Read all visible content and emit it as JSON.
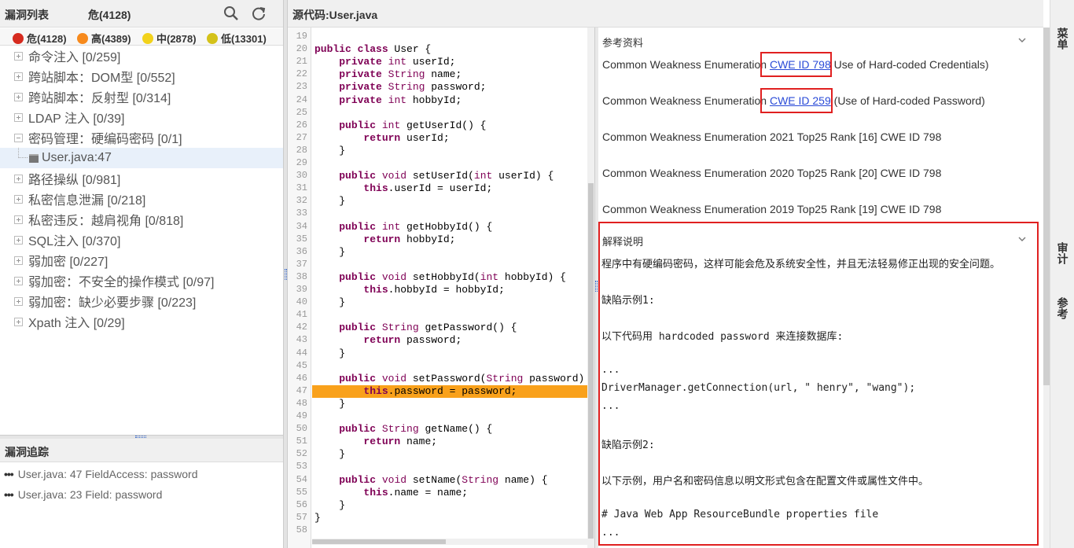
{
  "left_panel": {
    "title": "漏洞列表",
    "high_summary": "危(4128)",
    "search_icon": "search-icon",
    "refresh_icon": "refresh-icon",
    "severity": [
      {
        "label": "危(4128)",
        "color": "#d62b1f"
      },
      {
        "label": "高(4389)",
        "color": "#f78a1d"
      },
      {
        "label": "中(2878)",
        "color": "#f2d21b"
      },
      {
        "label": "低(13301)",
        "color": "#d4c21a"
      }
    ],
    "tree": [
      {
        "label": "命令注入 [0/259]",
        "expanded": false
      },
      {
        "label": "跨站脚本：DOM型 [0/552]",
        "expanded": false
      },
      {
        "label": "跨站脚本：反射型 [0/314]",
        "expanded": false
      },
      {
        "label": "LDAP 注入 [0/39]",
        "expanded": false
      },
      {
        "label": "密码管理：硬编码密码 [0/1]",
        "expanded": true
      },
      {
        "label": "User.java:47",
        "leaf": true
      },
      {
        "label": "路径操纵 [0/981]",
        "expanded": false
      },
      {
        "label": "私密信息泄漏 [0/218]",
        "expanded": false
      },
      {
        "label": "私密违反：越肩视角 [0/818]",
        "expanded": false
      },
      {
        "label": "SQL注入 [0/370]",
        "expanded": false
      },
      {
        "label": "弱加密 [0/227]",
        "expanded": false
      },
      {
        "label": "弱加密：不安全的操作模式 [0/97]",
        "expanded": false
      },
      {
        "label": "弱加密：缺少必要步骤 [0/223]",
        "expanded": false
      },
      {
        "label": "Xpath 注入 [0/29]",
        "expanded": false
      }
    ]
  },
  "trace_panel": {
    "title": "漏洞追踪",
    "items": [
      "User.java: 47 FieldAccess: password",
      "User.java: 23 Field: password"
    ]
  },
  "source": {
    "title": "源代码:User.java",
    "highlight_line": "47"
  },
  "references": {
    "title": "参考资料",
    "items": [
      {
        "prefix": "Common Weakness Enumeration ",
        "link": "CWE ID 798",
        "suffix": " Use of Hard-coded Credentials)"
      },
      {
        "prefix": "Common Weakness Enumeration ",
        "link": "CWE ID 259",
        "suffix": " (Use of Hard-coded Password)"
      },
      {
        "prefix": "Common Weakness Enumeration 2021 Top25 Rank [16] CWE ID 798",
        "link": "",
        "suffix": ""
      },
      {
        "prefix": "Common Weakness Enumeration 2020 Top25 Rank [20] CWE ID 798",
        "link": "",
        "suffix": ""
      },
      {
        "prefix": "Common Weakness Enumeration 2019 Top25 Rank [19] CWE ID 798",
        "link": "",
        "suffix": ""
      }
    ]
  },
  "explanation": {
    "title": "解释说明",
    "lines": [
      "程序中有硬编码密码，这样可能会危及系统安全性，并且无法轻易修正出现的安全问题。",
      "缺陷示例1:",
      "以下代码用 hardcoded password 来连接数据库:",
      "...",
      "DriverManager.getConnection(url, \" henry\", \"wang\");",
      "...",
      "缺陷示例2:",
      "以下示例，用户名和密码信息以明文形式包含在配置文件或属性文件中。",
      "# Java Web App ResourceBundle properties file",
      "..."
    ]
  },
  "right_tabs": [
    "菜单",
    "审计",
    "参考"
  ]
}
